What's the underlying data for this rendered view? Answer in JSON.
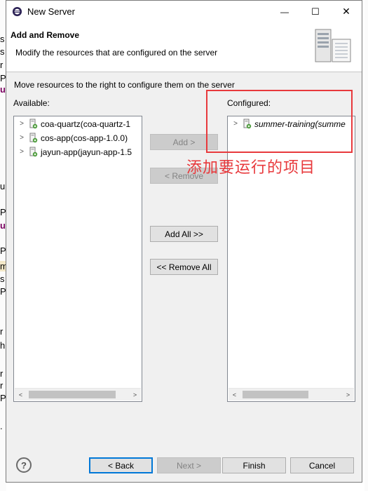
{
  "window": {
    "title": "New Server",
    "minimize_glyph": "—",
    "maximize_glyph": "☐",
    "close_glyph": "✕"
  },
  "banner": {
    "title": "Add and Remove",
    "description": "Modify the resources that are configured on the server",
    "icon": "server-icon"
  },
  "instruction": "Move resources to the right to configure them on the server",
  "available": {
    "label": "Available:",
    "items": [
      {
        "label": "coa-quartz(coa-quartz-1",
        "icon": "server-module-icon"
      },
      {
        "label": "cos-app(cos-app-1.0.0)",
        "icon": "server-module-icon"
      },
      {
        "label": "jayun-app(jayun-app-1.5",
        "icon": "server-module-icon"
      }
    ]
  },
  "configured": {
    "label": "Configured:",
    "items": [
      {
        "label": "summer-training(summe",
        "icon": "server-module-icon"
      }
    ]
  },
  "buttons": {
    "add": "Add >",
    "remove": "< Remove",
    "add_all": "Add All >>",
    "remove_all": "<< Remove All",
    "back": "< Back",
    "next": "Next >",
    "finish": "Finish",
    "cancel": "Cancel"
  },
  "annotation": {
    "text": "添加要运行的项目",
    "color": "#e8393c"
  },
  "background_fragments": [
    "s",
    "s",
    "r",
    "P",
    "u",
    "u",
    "P",
    "u",
    "P",
    "u",
    "m",
    "s",
    "P",
    "r",
    "h",
    "r",
    "r",
    "P",
    "u",
    "."
  ]
}
